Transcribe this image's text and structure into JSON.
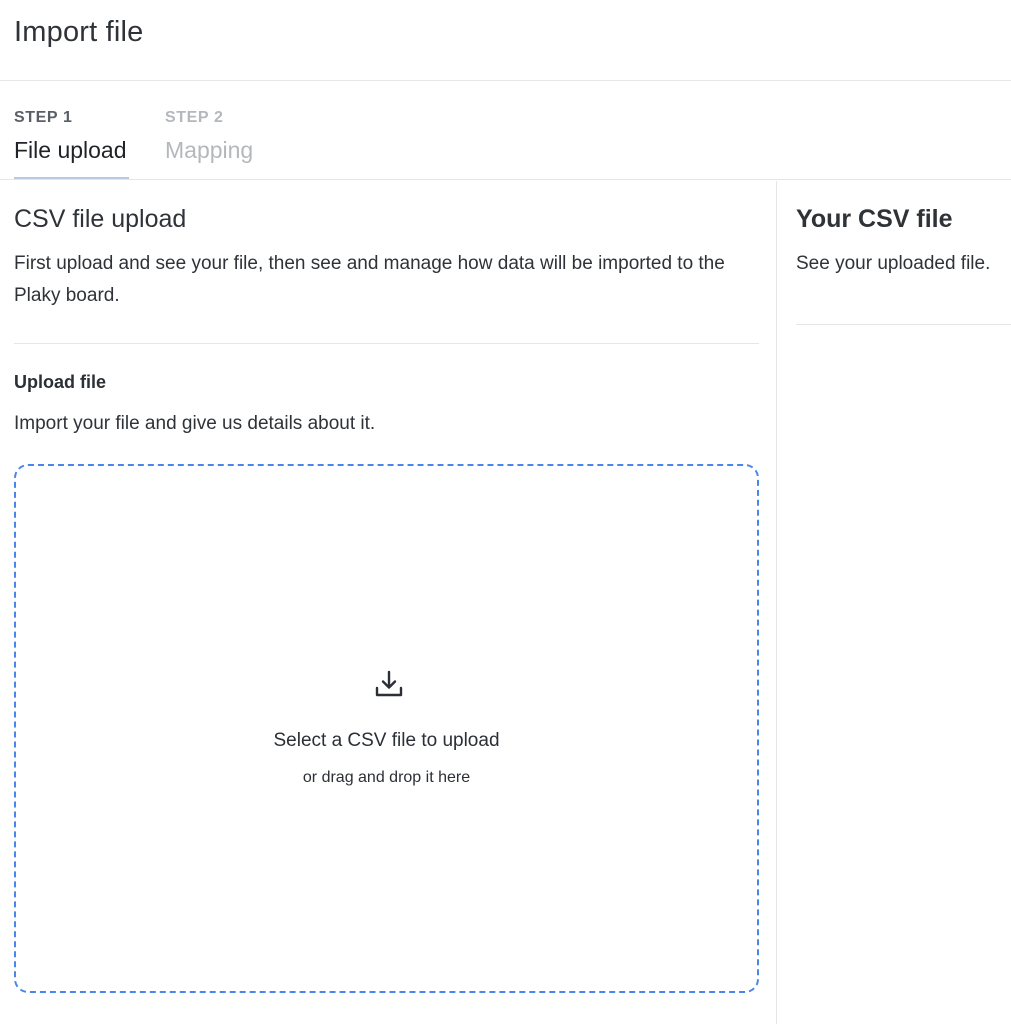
{
  "header": {
    "title": "Import file"
  },
  "steps": [
    {
      "number": "STEP 1",
      "label": "File upload",
      "active": true
    },
    {
      "number": "STEP 2",
      "label": "Mapping",
      "active": false
    }
  ],
  "upload_section": {
    "title": "CSV file upload",
    "description": "First upload and see your file, then see and manage how data will be imported to the Plaky board.",
    "upload_title": "Upload file",
    "upload_description": "Import your file and give us details about it.",
    "dropzone": {
      "icon": "download-icon",
      "primary_text": "Select a CSV file to upload",
      "secondary_text": "or drag and drop it here"
    }
  },
  "preview_section": {
    "title": "Your CSV file",
    "description": "See your uploaded file."
  },
  "colors": {
    "dropzone_border": "#4a86e8",
    "active_step_underline": "#b7cbe0",
    "inactive_step": "#b4b8bd"
  }
}
